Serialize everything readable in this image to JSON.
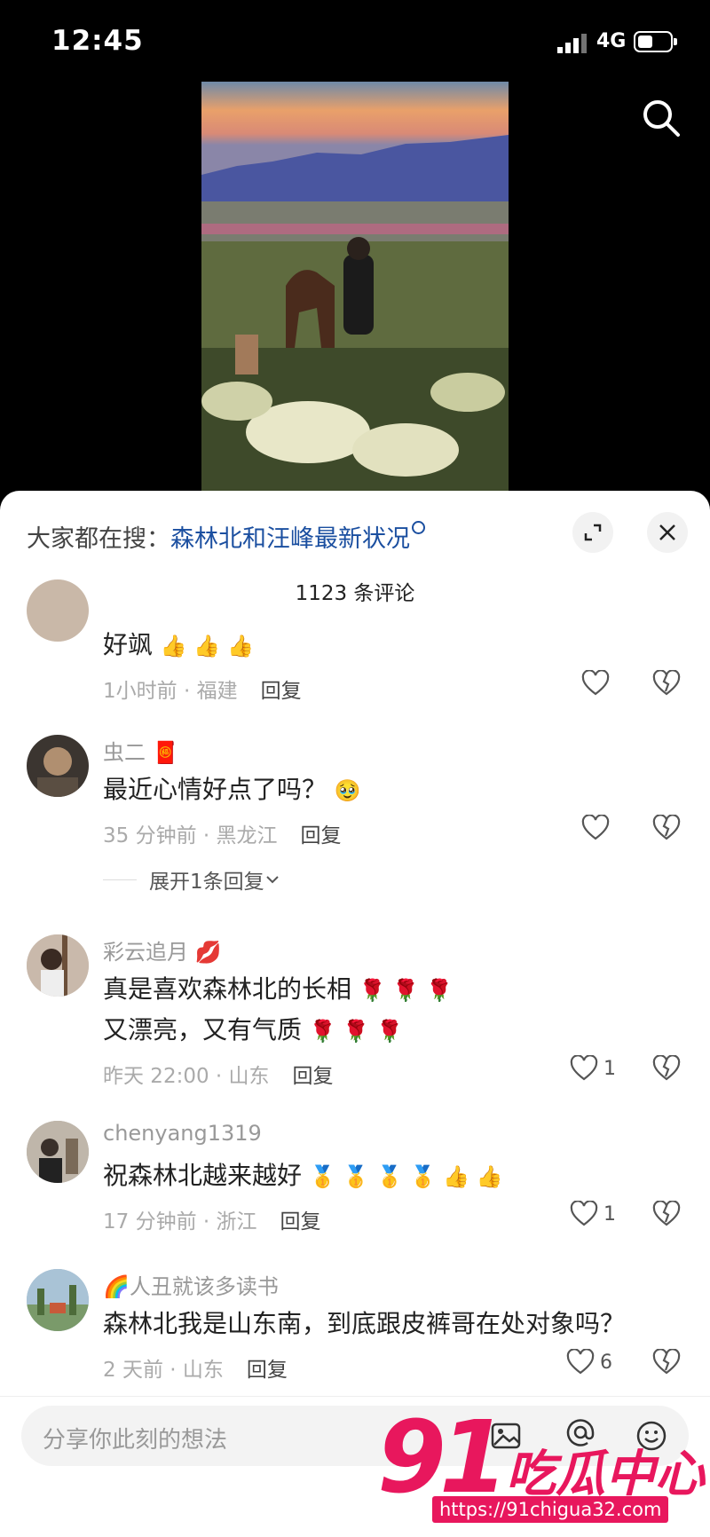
{
  "status": {
    "time": "12:45",
    "network": "4G"
  },
  "hot_search": {
    "prefix": "大家都在搜：",
    "keyword": "森林北和汪峰最新状况"
  },
  "comment_count": "1123 条评论",
  "comments": [
    {
      "username": "",
      "text": "好飒",
      "emojis": "👍 👍 👍",
      "time_loc": "1小时前 · 福建",
      "reply_label": "回复",
      "likes": ""
    },
    {
      "username": "虫二",
      "badge": "🧧",
      "text": "最近心情好点了吗？",
      "emojis": "🥹",
      "time_loc": "35 分钟前 · 黑龙江",
      "reply_label": "回复",
      "likes": "",
      "expand": "展开1条回复"
    },
    {
      "username": "彩云追月",
      "badge": "💋",
      "text": "真是喜欢森林北的长相",
      "emojis": "🌹 🌹 🌹",
      "text2": "又漂亮，又有气质",
      "emojis2": "🌹 🌹 🌹",
      "time_loc": "昨天 22:00 · 山东",
      "reply_label": "回复",
      "likes": "1"
    },
    {
      "username": "chenyang1319",
      "text": "祝森林北越来越好",
      "emojis": "🥇 🥇 🥇 🥇 👍 👍",
      "time_loc": "17 分钟前 · 浙江",
      "reply_label": "回复",
      "likes": "1"
    },
    {
      "username": "人丑就该多读书",
      "badge": "🌈",
      "text": "森林北我是山东南，到底跟皮裤哥在处对象吗？",
      "time_loc": "2 天前 · 山东",
      "reply_label": "回复",
      "likes": "6"
    }
  ],
  "composer": {
    "placeholder": "分享你此刻的想法"
  },
  "watermark": {
    "num": "91",
    "cn": "吃瓜中心",
    "url": "https://91chigua32.com"
  },
  "colors": {
    "accent": "#1b4fa0",
    "watermark": "#e8175d"
  }
}
